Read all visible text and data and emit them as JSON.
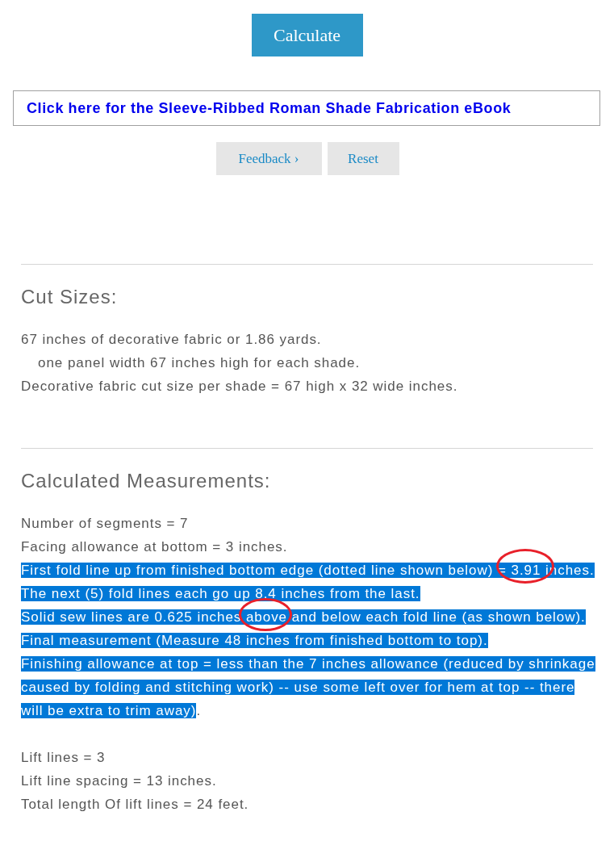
{
  "calculate_button": "Calculate",
  "ebook_link": "Click here for the Sleeve-Ribbed Roman Shade Fabrication eBook",
  "buttons": [
    "Feedback ›",
    "Reset"
  ],
  "sections": [
    {
      "heading": "Cut Sizes:",
      "blocks": [
        [
          {
            "text": "67 inches of decorative fabric or 1.86 yards.",
            "kind": "plain",
            "highlighted": false
          },
          {
            "text": "one panel width 67 inches high for each shade.",
            "kind": "indented",
            "highlighted": false
          },
          {
            "text": "Decorative fabric cut size per shade = 67 high x 32 wide inches.",
            "kind": "plain",
            "highlighted": false
          }
        ]
      ]
    },
    {
      "heading": "Calculated Measurements:",
      "annotations": [
        {
          "kind": "circle"
        },
        {
          "kind": "circle"
        }
      ],
      "blocks": [
        [
          {
            "text": "Number of segments = 7",
            "kind": "plain",
            "highlighted": false
          },
          {
            "text": "Facing allowance at bottom = 3 inches.",
            "kind": "plain",
            "highlighted": false
          },
          {
            "text": "First fold line up from finished bottom edge (dotted line shown below) = 3.91 inches.",
            "kind": "plain",
            "highlighted": true
          },
          {
            "text": "The next (5) fold lines each go up 8.4 inches from the last.",
            "kind": "plain",
            "highlighted": true
          },
          {
            "text": "Solid sew lines are 0.625 inches above and below each fold line (as shown below).",
            "kind": "plain",
            "highlighted": true
          },
          {
            "text": "Final measurement (Measure 48 inches from finished bottom to top).",
            "kind": "plain",
            "highlighted": true
          },
          {
            "text": "Finishing allowance at top = less than the 7 inches allowance (reduced by shrinkage caused by folding and stitching work) -- use some left over for hem at top -- there will be extra to trim away)",
            "tail": ".",
            "kind": "plain",
            "highlighted": true
          }
        ],
        [
          {
            "text": "Lift lines = 3",
            "kind": "plain",
            "highlighted": false
          },
          {
            "text": "Lift line spacing = 13 inches.",
            "kind": "plain",
            "highlighted": false
          },
          {
            "text": "Total length Of lift lines = 24 feet.",
            "kind": "plain",
            "highlighted": false
          }
        ]
      ]
    }
  ]
}
